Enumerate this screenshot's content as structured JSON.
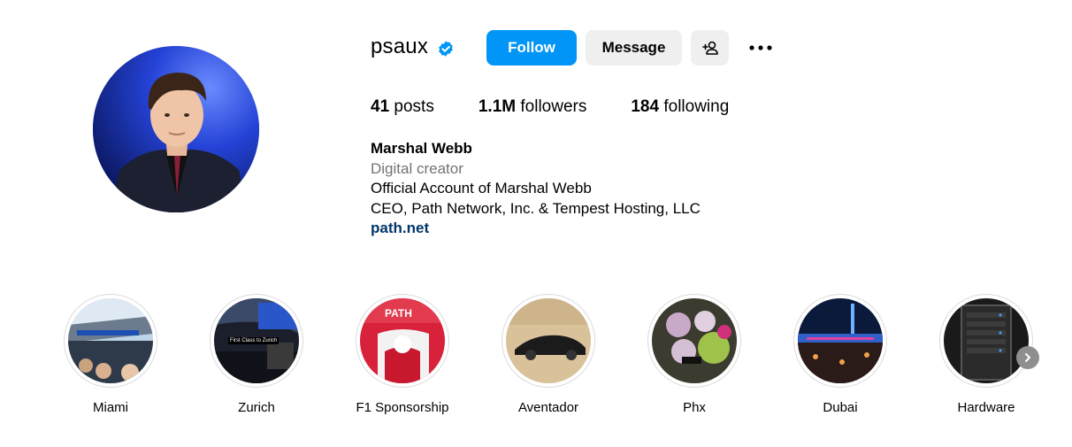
{
  "profile": {
    "username": "psaux",
    "verified_icon": "verified-badge-icon",
    "follow_label": "Follow",
    "message_label": "Message",
    "add_user_icon": "add-user-icon",
    "more_icon": "more-options-icon",
    "accent_color": "#0095f6"
  },
  "stats": {
    "posts_count": "41",
    "posts_label": "posts",
    "followers_count": "1.1M",
    "followers_label": "followers",
    "following_count": "184",
    "following_label": "following"
  },
  "bio": {
    "name": "Marshal Webb",
    "category": "Digital creator",
    "line1": "Official Account of Marshal Webb",
    "line2": "CEO, Path Network, Inc. & Tempest Hosting, LLC",
    "link": "path.net"
  },
  "highlights": [
    {
      "label": "Miami"
    },
    {
      "label": "Zurich",
      "overlay_text": "First Class to Zurich"
    },
    {
      "label": "F1 Sponsorship",
      "overlay_text": "PATH"
    },
    {
      "label": "Aventador"
    },
    {
      "label": "Phx"
    },
    {
      "label": "Dubai"
    },
    {
      "label": "Hardware"
    }
  ],
  "highlights_next_icon": "chevron-right-icon"
}
